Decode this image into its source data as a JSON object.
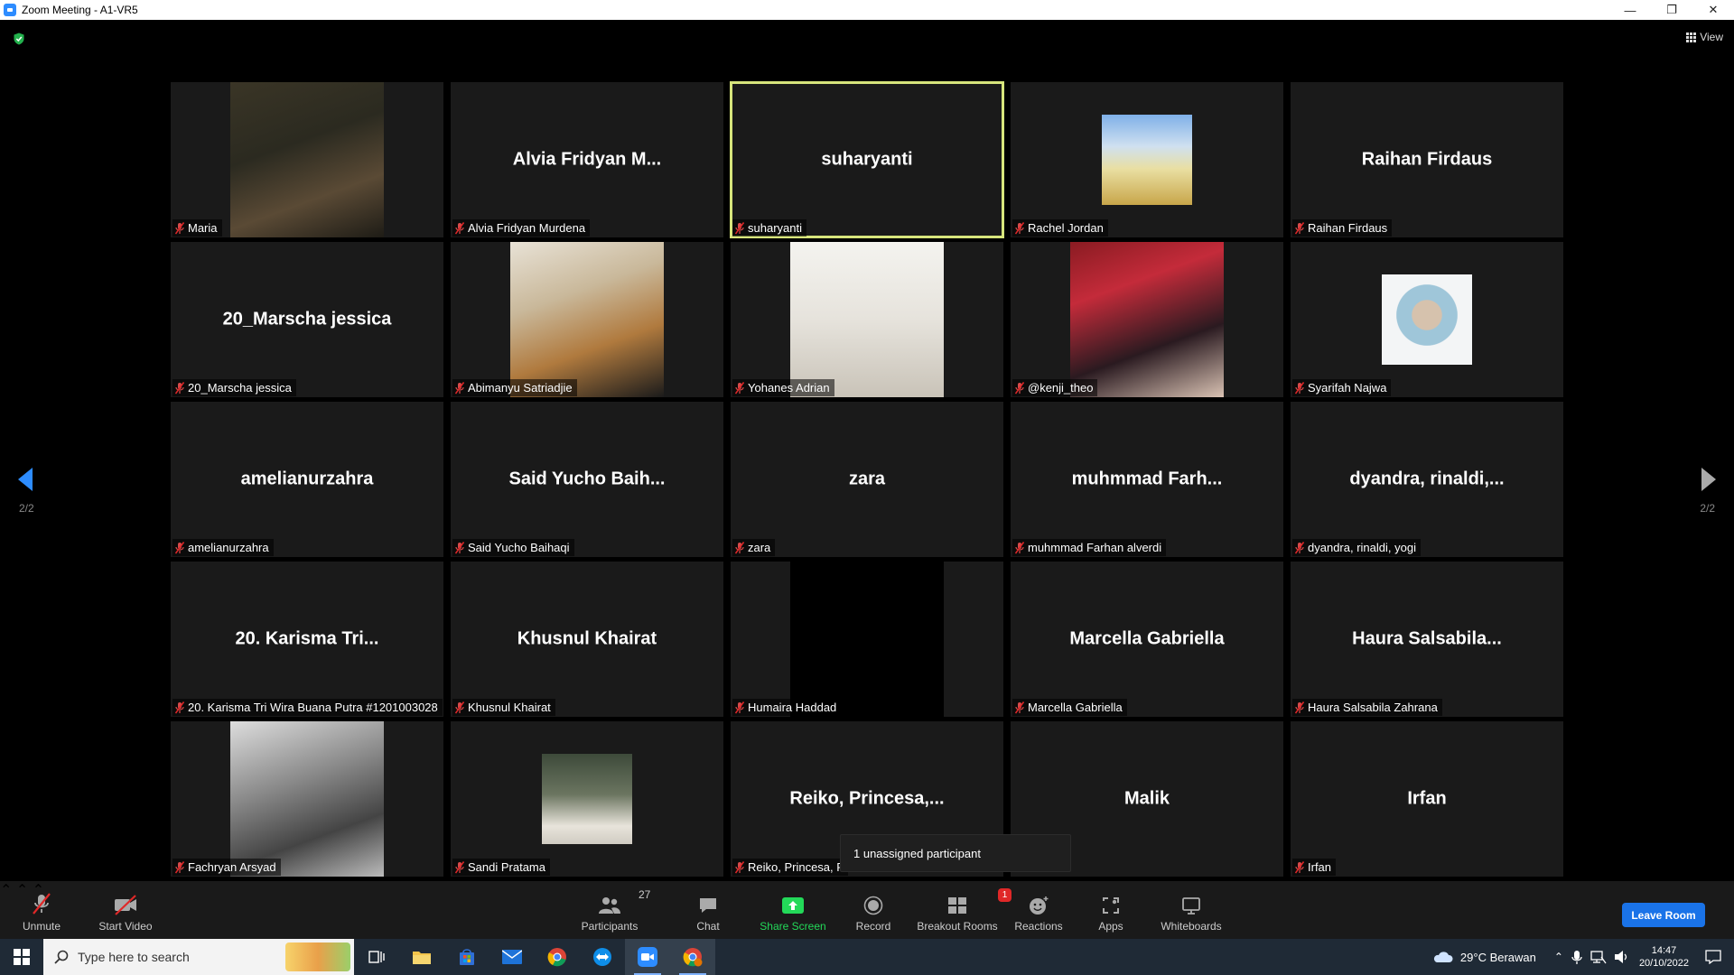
{
  "window": {
    "title": "Zoom Meeting - A1-VR5"
  },
  "top_bar": {
    "view_label": "View"
  },
  "pagination": {
    "left": "2/2",
    "right": "2/2"
  },
  "participants_grid": [
    {
      "display": "",
      "label": "Maria",
      "media": "video",
      "active": false
    },
    {
      "display": "Alvia  Fridyan  M...",
      "label": "Alvia Fridyan Murdena",
      "media": "name",
      "active": false
    },
    {
      "display": "suharyanti",
      "label": "suharyanti",
      "media": "name",
      "active": true
    },
    {
      "display": "",
      "label": "Rachel Jordan",
      "media": "photo-small",
      "active": false
    },
    {
      "display": "Raihan Firdaus",
      "label": "Raihan Firdaus",
      "media": "name",
      "active": false
    },
    {
      "display": "20_Marscha jessica",
      "label": "20_Marscha jessica",
      "media": "name",
      "active": false
    },
    {
      "display": "",
      "label": "Abimanyu Satriadjie",
      "media": "video",
      "active": false
    },
    {
      "display": "",
      "label": "Yohanes Adrian",
      "media": "video",
      "active": false
    },
    {
      "display": "",
      "label": "@kenji_theo",
      "media": "video",
      "active": false
    },
    {
      "display": "",
      "label": "Syarifah Najwa",
      "media": "photo-small",
      "active": false
    },
    {
      "display": "amelianurzahra",
      "label": "amelianurzahra",
      "media": "name",
      "active": false
    },
    {
      "display": "Said  Yucho  Baih...",
      "label": "Said Yucho Baihaqi",
      "media": "name",
      "active": false
    },
    {
      "display": "zara",
      "label": "zara",
      "media": "name",
      "active": false
    },
    {
      "display": "muhmmad  Farh...",
      "label": "muhmmad Farhan alverdi",
      "media": "name",
      "active": false
    },
    {
      "display": "dyandra,  rinaldi,...",
      "label": "dyandra, rinaldi, yogi",
      "media": "name",
      "active": false
    },
    {
      "display": "20.  Karisma  Tri...",
      "label": "20. Karisma Tri Wira Buana Putra #1201003028",
      "media": "name",
      "active": false
    },
    {
      "display": "Khusnul Khairat",
      "label": "Khusnul Khairat",
      "media": "name",
      "active": false
    },
    {
      "display": "",
      "label": "Humaira Haddad",
      "media": "black",
      "active": false
    },
    {
      "display": "Marcella Gabriella",
      "label": "Marcella Gabriella",
      "media": "name",
      "active": false
    },
    {
      "display": "Haura  Salsabila...",
      "label": "Haura Salsabila Zahrana",
      "media": "name",
      "active": false
    },
    {
      "display": "",
      "label": "Fachryan Arsyad",
      "media": "video",
      "active": false
    },
    {
      "display": "",
      "label": "Sandi Pratama",
      "media": "photo-small",
      "active": false
    },
    {
      "display": "Reiko,  Princesa,...",
      "label": "Reiko, Princesa, F",
      "media": "name",
      "active": false
    },
    {
      "display": "Malik",
      "label": "",
      "media": "name",
      "active": false
    },
    {
      "display": "Irfan",
      "label": "Irfan",
      "media": "name",
      "active": false
    }
  ],
  "tooltip": {
    "unassigned": "1 unassigned participant"
  },
  "toolbar": {
    "unmute": "Unmute",
    "start_video": "Start Video",
    "participants": "Participants",
    "participants_count": "27",
    "chat": "Chat",
    "share_screen": "Share Screen",
    "record": "Record",
    "breakout_rooms": "Breakout Rooms",
    "breakout_badge": "1",
    "reactions": "Reactions",
    "apps": "Apps",
    "whiteboards": "Whiteboards",
    "leave": "Leave Room"
  },
  "taskbar": {
    "search_placeholder": "Type here to search",
    "weather": "29°C  Berawan",
    "time": "14:47",
    "date": "20/10/2022"
  },
  "colors": {
    "accent_blue": "#2d8cff",
    "active_speaker": "#d7e57c",
    "share_green": "#23d959",
    "badge_red": "#e02828",
    "muted_red": "#e02828"
  }
}
